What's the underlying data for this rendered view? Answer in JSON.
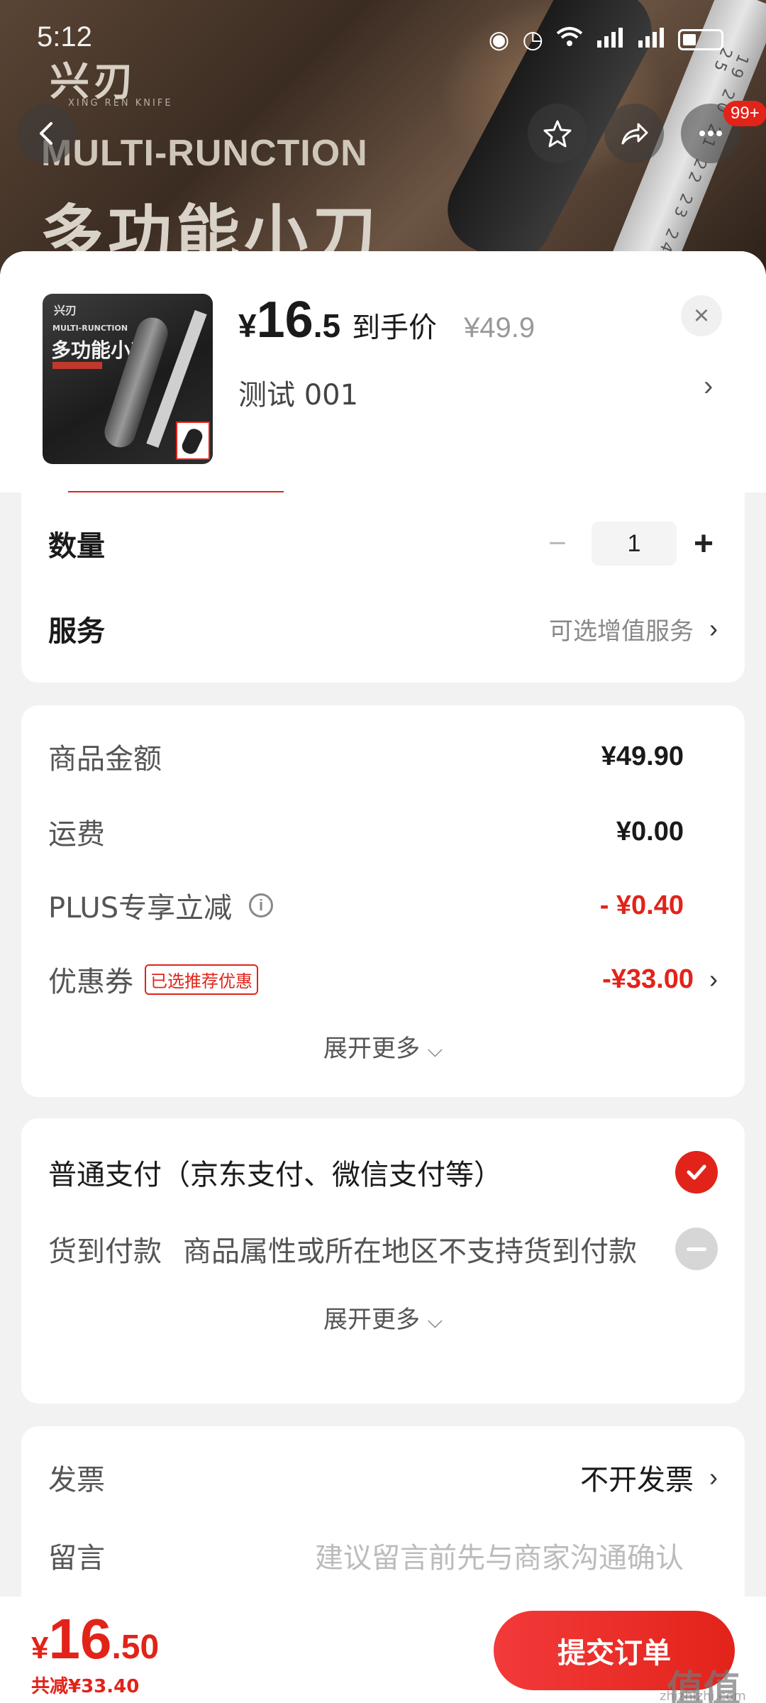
{
  "status_bar": {
    "time": "5:12"
  },
  "hero": {
    "brand": "兴刃",
    "brand_sub": "XING REN KNIFE",
    "headline_en": "MULTI-RUNCTION",
    "headline_cn": "多功能小刀",
    "ruler_marks": "19 20 21 22 23 24 25"
  },
  "top_actions": {
    "badge": "99+"
  },
  "product": {
    "thumb": {
      "brand": "兴刃",
      "en": "MULTI-RUNCTION",
      "cn": "多功能小刀"
    },
    "price_currency": "¥",
    "price_int": "16",
    "price_dec": ".5",
    "price_label": "到手价",
    "original_price": "¥49.9",
    "variant": "测试  001"
  },
  "quantity": {
    "label": "数量",
    "value": "1"
  },
  "service": {
    "label": "服务",
    "value": "可选增值服务"
  },
  "cost": {
    "goods_label": "商品金额",
    "goods_value": "¥49.90",
    "shipping_label": "运费",
    "shipping_value": "¥0.00",
    "plus_label": "PLUS专享立减",
    "plus_value": "- ¥0.40",
    "coupon_label": "优惠券",
    "coupon_tag": "已选推荐优惠",
    "coupon_value": "-¥33.00",
    "expand": "展开更多"
  },
  "payment": {
    "normal_label": "普通支付（京东支付、微信支付等）",
    "cod_label": "货到付款",
    "cod_note": "商品属性或所在地区不支持货到付款",
    "expand": "展开更多"
  },
  "extras": {
    "invoice_label": "发票",
    "invoice_value": "不开发票",
    "message_label": "留言",
    "message_placeholder": "建议留言前先与商家沟通确认"
  },
  "bottom": {
    "currency": "¥",
    "total_int": "16",
    "total_dec": ".50",
    "saved": "共减¥33.40",
    "submit": "提交订单"
  },
  "watermark": {
    "main": "值值值",
    "sub": "zhizhizhi.com"
  },
  "colors": {
    "accent": "#e2231a",
    "background": "#f2f2f2"
  }
}
